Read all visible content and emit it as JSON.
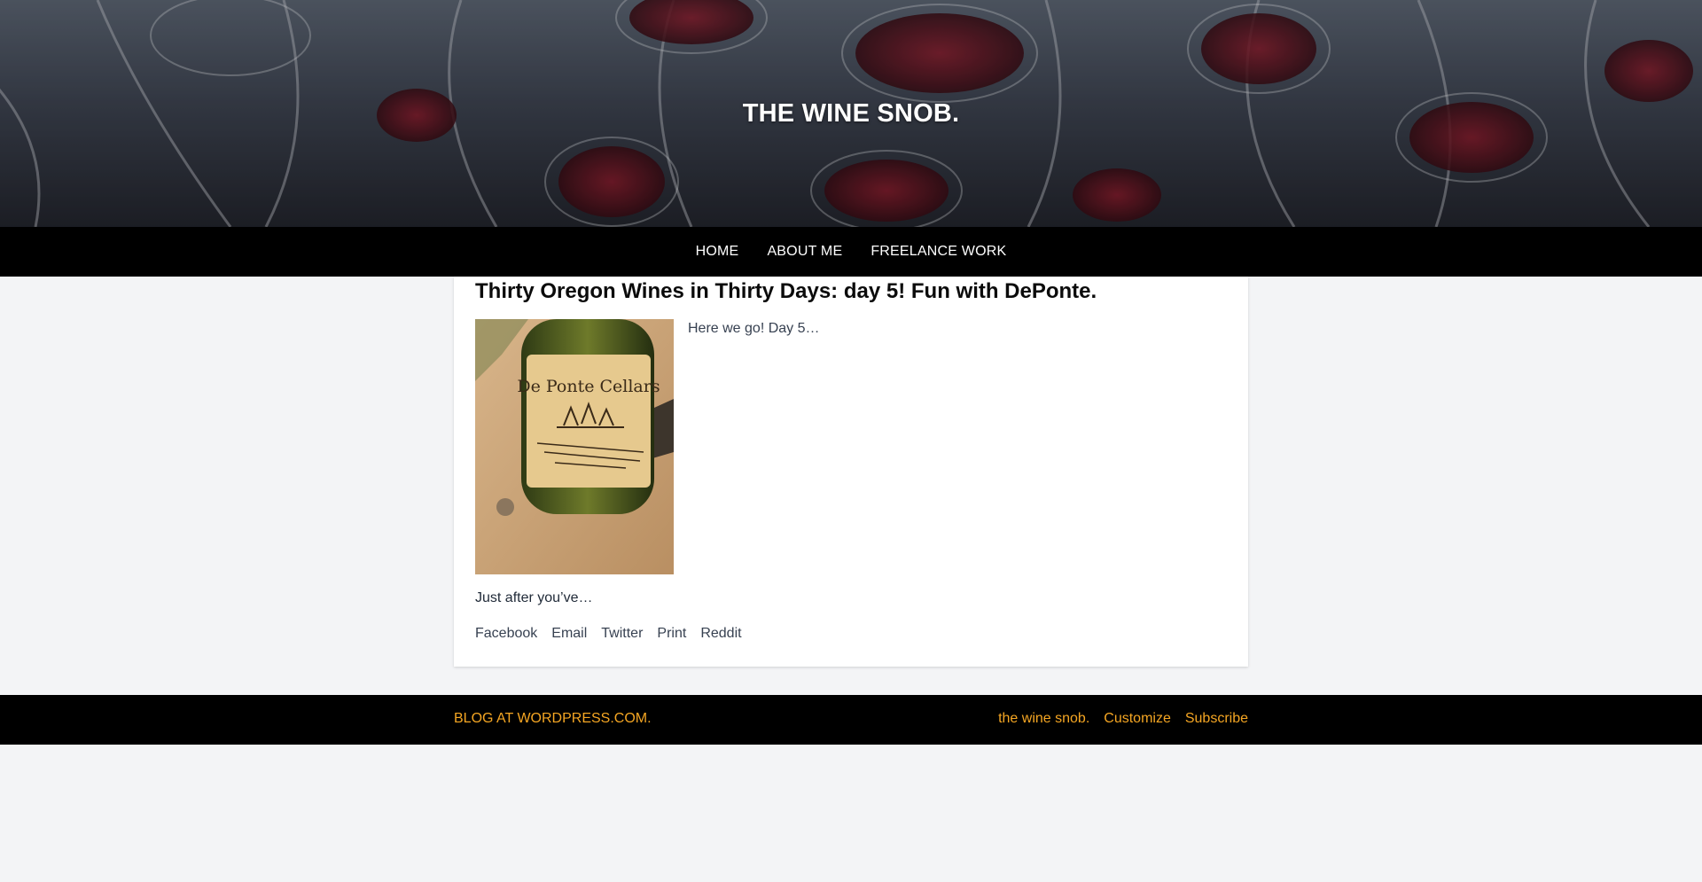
{
  "site": {
    "title": "THE WINE SNOB."
  },
  "nav": {
    "items": [
      "HOME",
      "ABOUT ME",
      "FREELANCE WORK"
    ]
  },
  "post": {
    "title": "Thirty Oregon Wines in Thirty Days: day 5! Fun with DePonte.",
    "excerpt": "Here we go! Day 5…",
    "continued": "Just after you’ve…",
    "image_label": "De Ponte Cellars",
    "share": [
      "Facebook",
      "Email",
      "Twitter",
      "Print",
      "Reddit"
    ]
  },
  "footer": {
    "credit": "BLOG AT WORDPRESS.COM.",
    "links": [
      "the wine snob.",
      "Customize",
      "Subscribe"
    ]
  },
  "colors": {
    "nav_bg": "#000000",
    "footer_link": "#f5a623",
    "page_bg": "#f3f4f6"
  }
}
